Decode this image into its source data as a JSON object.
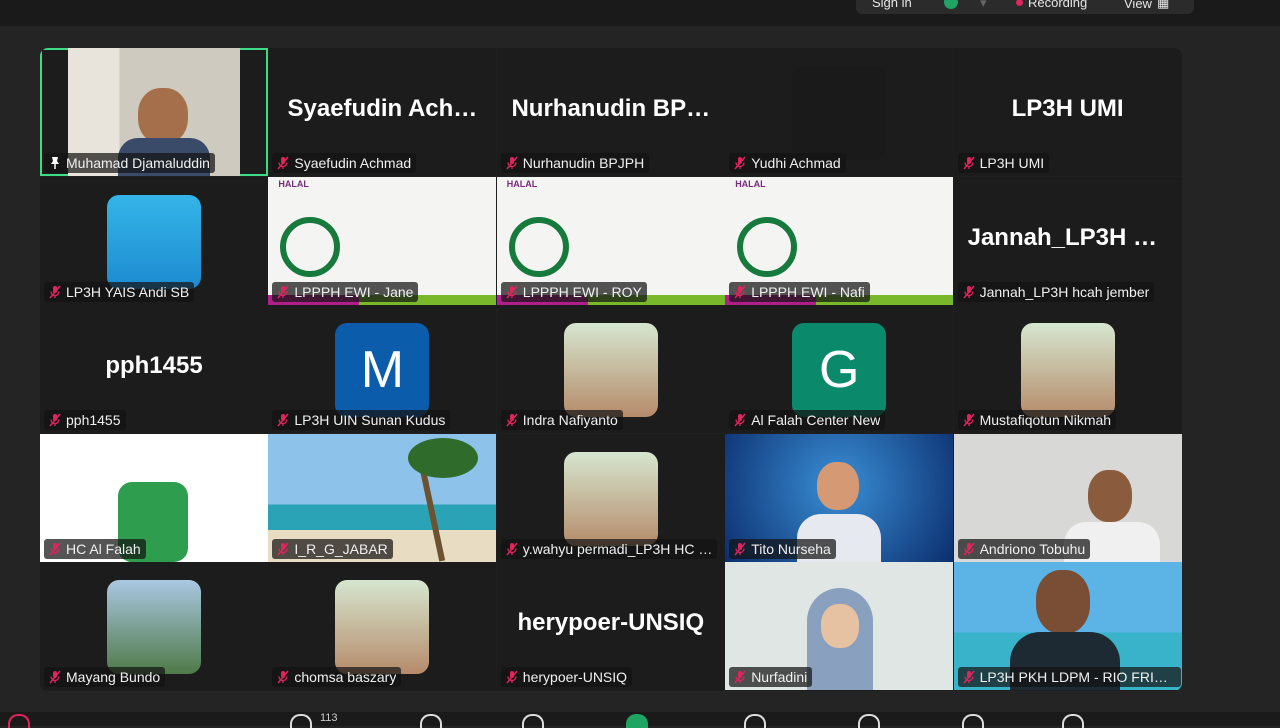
{
  "topbar": {
    "sign_in": "Sign in",
    "recording": "Recording",
    "view": "View"
  },
  "participants": [
    {
      "name": "Muhamad Djamaluddin",
      "pinned": true,
      "active": true,
      "video": "person-office"
    },
    {
      "name": "Syaefudin Achmad",
      "display": "Syaefudin  Ach…",
      "muted": true
    },
    {
      "name": "Nurhanudin BPJPH",
      "display": "Nurhanudin  BP…",
      "muted": true
    },
    {
      "name": "Yudhi Achmad",
      "muted": true,
      "avatar": "mosque-crescent-icon"
    },
    {
      "name": "LP3H UMI",
      "display": "LP3H UMI",
      "muted": true
    },
    {
      "name": "LP3H YAIS Andi SB",
      "muted": true,
      "avatar": "dove-icon"
    },
    {
      "name": "LPPPH EWI - Jane",
      "muted": true,
      "video": "halal-ewi-logo"
    },
    {
      "name": "LPPPH EWI - ROY",
      "muted": true,
      "video": "halal-ewi-logo"
    },
    {
      "name": "LPPPH EWI - Nafi",
      "muted": true,
      "video": "halal-ewi-logo"
    },
    {
      "name": "Jannah_LP3H hcah jember",
      "display": "Jannah_LP3H  h…",
      "muted": true
    },
    {
      "name": "pph1455",
      "display": "pph1455",
      "muted": true
    },
    {
      "name": "LP3H UIN Sunan Kudus",
      "muted": true,
      "avatar_letter": "M",
      "avatar_color": "#0b5cab"
    },
    {
      "name": "Indra Nafiyanto",
      "muted": true,
      "avatar": "person-photo"
    },
    {
      "name": "Al Falah Center New",
      "muted": true,
      "avatar_letter": "G",
      "avatar_color": "#0a8a6a"
    },
    {
      "name": "Mustafiqotun Nikmah",
      "muted": true,
      "avatar": "person-photo"
    },
    {
      "name": "HC Al Falah",
      "muted": true,
      "video": "book-crescent-logo"
    },
    {
      "name": "I_R_G_JABAR",
      "muted": true,
      "video": "beach-palm"
    },
    {
      "name": "y.wahyu permadi_LP3H HC …",
      "muted": true,
      "avatar": "person-photo"
    },
    {
      "name": "Tito Nurseha",
      "muted": true,
      "video": "avatar-3d"
    },
    {
      "name": "Andriono Tobuhu",
      "muted": true,
      "video": "person-room"
    },
    {
      "name": "Mayang Bundo",
      "muted": true,
      "avatar": "person-mountain"
    },
    {
      "name": "chomsa baszary",
      "muted": true,
      "avatar": "person-photo"
    },
    {
      "name": "herypoer-UNSIQ",
      "display": "herypoer-UNSIQ",
      "muted": true
    },
    {
      "name": "Nurfadini",
      "muted": true,
      "video": "person-hijab"
    },
    {
      "name": "LP3H PKH LDPM - RIO FRIYA…",
      "muted": true,
      "video": "person-beach"
    }
  ],
  "bottombar": {
    "participants_count": "113"
  },
  "colors": {
    "active_border": "#3ddc84",
    "mute_red": "#e0245e"
  }
}
